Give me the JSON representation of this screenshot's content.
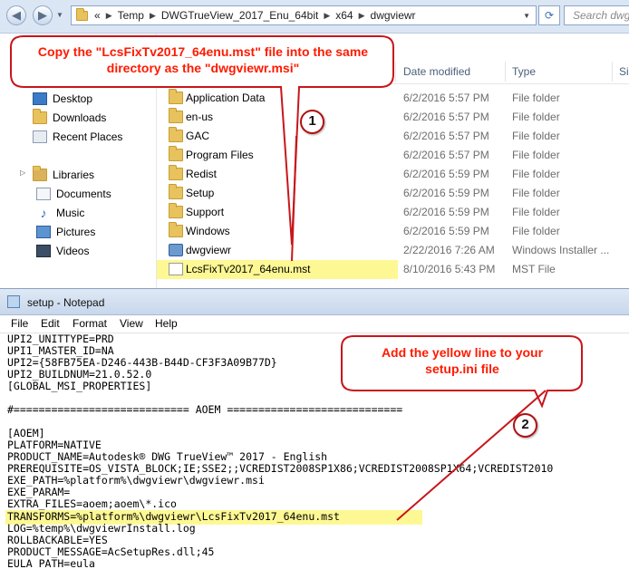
{
  "explorer": {
    "address_crumbs": [
      "«",
      "Temp",
      "DWGTrueView_2017_Enu_64bit",
      "x64",
      "dwgviewr"
    ],
    "search_placeholder": "Search dwg",
    "nav_items": [
      {
        "label": "Desktop",
        "icon": "desktop-icon"
      },
      {
        "label": "Downloads",
        "icon": "downloads-icon"
      },
      {
        "label": "Recent Places",
        "icon": "recent-places-icon"
      },
      {
        "label": "Libraries",
        "icon": "libraries-icon"
      },
      {
        "label": "Documents",
        "icon": "documents-icon"
      },
      {
        "label": "Music",
        "icon": "music-icon"
      },
      {
        "label": "Pictures",
        "icon": "pictures-icon"
      },
      {
        "label": "Videos",
        "icon": "videos-icon"
      }
    ],
    "columns": {
      "date": "Date modified",
      "type": "Type",
      "size": "Si"
    },
    "files": [
      {
        "name": "Application Data",
        "date": "6/2/2016 5:57 PM",
        "type": "File folder",
        "icon": "folder-icon"
      },
      {
        "name": "en-us",
        "date": "6/2/2016 5:57 PM",
        "type": "File folder",
        "icon": "folder-icon"
      },
      {
        "name": "GAC",
        "date": "6/2/2016 5:57 PM",
        "type": "File folder",
        "icon": "folder-icon"
      },
      {
        "name": "Program Files",
        "date": "6/2/2016 5:57 PM",
        "type": "File folder",
        "icon": "folder-icon"
      },
      {
        "name": "Redist",
        "date": "6/2/2016 5:59 PM",
        "type": "File folder",
        "icon": "folder-icon"
      },
      {
        "name": "Setup",
        "date": "6/2/2016 5:59 PM",
        "type": "File folder",
        "icon": "folder-icon"
      },
      {
        "name": "Support",
        "date": "6/2/2016 5:59 PM",
        "type": "File folder",
        "icon": "folder-icon"
      },
      {
        "name": "Windows",
        "date": "6/2/2016 5:59 PM",
        "type": "File folder",
        "icon": "folder-icon"
      },
      {
        "name": "dwgviewr",
        "date": "2/22/2016 7:26 AM",
        "type": "Windows Installer ...",
        "icon": "msi-installer-icon"
      },
      {
        "name": "LcsFixTv2017_64enu.mst",
        "date": "8/10/2016 5:43 PM",
        "type": "MST File",
        "icon": "file-icon"
      }
    ]
  },
  "notepad": {
    "title": "setup - Notepad",
    "menu": [
      "File",
      "Edit",
      "Format",
      "View",
      "Help"
    ],
    "lines": [
      "UPI2_UNITTYPE=PRD",
      "UPI1_MASTER_ID=NA",
      "UPI2={58FB75EA-D246-443B-B44D-CF3F3A09B77D}",
      "UPI2_BUILDNUM=21.0.52.0",
      "[GLOBAL_MSI_PROPERTIES]",
      "",
      "#============================ AOEM ============================",
      "",
      "[AOEM]",
      "PLATFORM=NATIVE",
      "PRODUCT_NAME=Autodesk® DWG TrueView™ 2017 - English",
      "PREREQUISITE=OS_VISTA_BLOCK;IE;SSE2;;VCREDIST2008SP1X86;VCREDIST2008SP1X64;VCREDIST2010",
      "EXE_PATH=%platform%\\dwgviewr\\dwgviewr.msi",
      "EXE_PARAM=",
      "EXTRA_FILES=aoem;aoem\\*.ico",
      "TRANSFORMS=%platform%\\dwgviewr\\LcsFixTv2017_64enu.mst",
      "LOG=%temp%\\dwgviewrInstall.log",
      "ROLLBACKABLE=YES",
      "PRODUCT_MESSAGE=AcSetupRes.dll;45",
      "EULA_PATH=eula"
    ]
  },
  "callouts": {
    "first": {
      "text": "Copy the \"LcsFixTv2017_64enu.mst\" file into the same directory as the \"dwgviewr.msi\"",
      "number": "1"
    },
    "second": {
      "text": "Add the yellow line to your setup.ini file",
      "number": "2"
    }
  },
  "colors": {
    "callout_red": "#c8161b",
    "callout_text": "#ff1a00",
    "highlight_yellow": "#fdf894"
  }
}
